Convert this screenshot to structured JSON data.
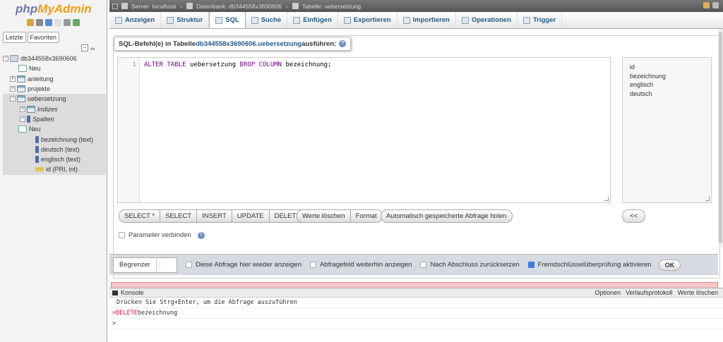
{
  "nav": {
    "logo_php": "php",
    "logo_myadmin": "MyAdmin",
    "tab_recent": "Letzte",
    "tab_favorites": "Favoriten",
    "tree": [
      {
        "label": "db344558x3690606",
        "type": "db",
        "expand": "−"
      },
      {
        "label": "Neu",
        "type": "new"
      },
      {
        "label": "anleitung",
        "type": "tbl",
        "expand": "+"
      },
      {
        "label": "projekte",
        "type": "tbl",
        "expand": "+"
      },
      {
        "label": "uebersetzung",
        "type": "tbl",
        "expand": "−"
      },
      {
        "label": "Indizes",
        "type": "idx",
        "expand": "+"
      },
      {
        "label": "Spalten",
        "type": "cols",
        "expand": "−"
      },
      {
        "label": "Neu",
        "type": "new"
      },
      {
        "label": "bezeichnung (text)",
        "type": "col"
      },
      {
        "label": "deutsch (text)",
        "type": "col"
      },
      {
        "label": "englisch (text)",
        "type": "col"
      },
      {
        "label": "id (PRI, int)",
        "type": "key"
      }
    ]
  },
  "breadcrumb": {
    "server": "Server: localhost",
    "database": "Datenbank: db344558x3690606",
    "table": "Tabelle: uebersetzung",
    "sep": "»"
  },
  "tabs": [
    "Anzeigen",
    "Struktur",
    "SQL",
    "Suche",
    "Einfügen",
    "Exportieren",
    "Importieren",
    "Operationen",
    "Trigger"
  ],
  "active_tab": "SQL",
  "legend": {
    "prefix": "SQL-Befehl(e) in Tabelle ",
    "link": "db344558x3690606.uebersetzung",
    "suffix": " ausführen:"
  },
  "editor": {
    "line_number": "1",
    "kw1": "ALTER TABLE",
    "id1": " uebersetzung ",
    "kw2": "DROP COLUMN",
    "id2": " bezeichnung;"
  },
  "columns_list": [
    "id",
    "bezeichnung",
    "englisch",
    "deutsch"
  ],
  "buttons": {
    "select_star": "SELECT *",
    "select": "SELECT",
    "insert": "INSERT",
    "update": "UPDATE",
    "delete": "DELETE",
    "clear": "Werte löschen",
    "format": "Format",
    "autosave": "Automatisch gespeicherte Abfrage holen",
    "insert_col": "<<"
  },
  "bind_params": "Parameter verbinden",
  "options": {
    "delimiter_label": "Begrenzer",
    "delimiter_value": ";",
    "retain": "Diese Abfrage hier wieder anzeigen",
    "show_field": "Abfragefeld weiterhin anzeigen",
    "rollback": "Nach Abschluss zurücksetzen",
    "fk_checks": "Fremdschlüsselüberprüfung aktivieren",
    "ok": "OK"
  },
  "console": {
    "title": "Konsole",
    "options": "Optionen",
    "history": "Verlaufsprotokoll",
    "clear": "Werte löschen",
    "hint": "Drücken Sie Strg+Enter, um die Abfrage auszuführen",
    "query_prefix": "=DELETE",
    "query_rest": " bezeichnung",
    "prompt": ">"
  }
}
